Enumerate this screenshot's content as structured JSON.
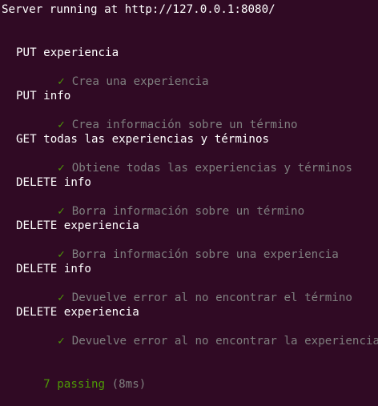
{
  "terminal": {
    "server_message": "Server running at http://127.0.0.1:8080/",
    "suites": [
      {
        "title": "PUT experiencia",
        "test": "Crea una experiencia"
      },
      {
        "title": "PUT info",
        "test": "Crea información sobre un término"
      },
      {
        "title": "GET todas las experiencias y términos",
        "test": "Obtiene todas las experiencias y términos"
      },
      {
        "title": "DELETE info",
        "test": "Borra información sobre un término"
      },
      {
        "title": "DELETE experiencia",
        "test": "Borra información sobre una experiencia"
      },
      {
        "title": "DELETE info",
        "test": "Devuelve error al no encontrar el término"
      },
      {
        "title": "DELETE experiencia",
        "test": "Devuelve error al no encontrar la experiencia"
      }
    ],
    "check_glyph": "✓",
    "summary": {
      "passing": "7 passing",
      "duration": "(8ms)"
    },
    "colors": {
      "background": "#300a24",
      "pass_green": "#4e9a06",
      "dim_gray": "#7f7f7f",
      "text_white": "#ffffff"
    }
  }
}
